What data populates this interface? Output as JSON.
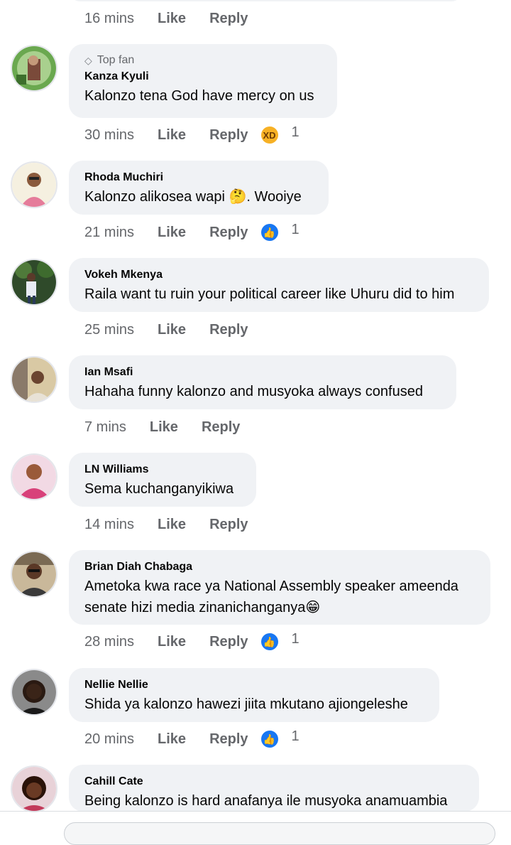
{
  "actions": {
    "like_label": "Like",
    "reply_label": "Reply"
  },
  "top_row": {
    "time": "16 mins"
  },
  "comments": [
    {
      "badge": "Top fan",
      "name": "Kanza Kyuli",
      "text": "Kalonzo tena God have mercy on us",
      "time": "30 mins",
      "reaction_icon": "laughing-emoji-icon",
      "reaction_count": "1"
    },
    {
      "name": "Rhoda Muchiri",
      "text": "Kalonzo alikosea wapi 🤔. Wooiye",
      "time": "21 mins",
      "reaction_icon": "like-reaction-icon",
      "reaction_count": "1"
    },
    {
      "name": "Vokeh Mkenya",
      "text": "Raila want tu ruin your political career like Uhuru did to him",
      "time": "25 mins"
    },
    {
      "name": "Ian Msafi",
      "text": "Hahaha funny kalonzo and musyoka always confused",
      "time": "7 mins"
    },
    {
      "name": "LN Williams",
      "text": "Sema kuchanganyikiwa",
      "time": "14 mins"
    },
    {
      "name": "Brian Diah Chabaga",
      "text_lines": [
        "Ametoka kwa race ya National Assembly speaker ameenda",
        "senate hizi media zinanichanganya😁"
      ],
      "time": "28 mins",
      "reaction_icon": "like-reaction-icon",
      "reaction_count": "1"
    },
    {
      "name": "Nellie Nellie",
      "text": "Shida ya kalonzo hawezi jiita mkutano ajiongeleshe",
      "time": "20 mins",
      "reaction_icon": "like-reaction-icon",
      "reaction_count": "1"
    },
    {
      "name": "Cahill Cate",
      "text": "Being kalonzo is hard anafanya ile musyoka anamuambia"
    }
  ],
  "colors": {
    "bubble": "#f0f2f5",
    "meta_text": "#65676b",
    "like_blue": "#1877f2"
  }
}
